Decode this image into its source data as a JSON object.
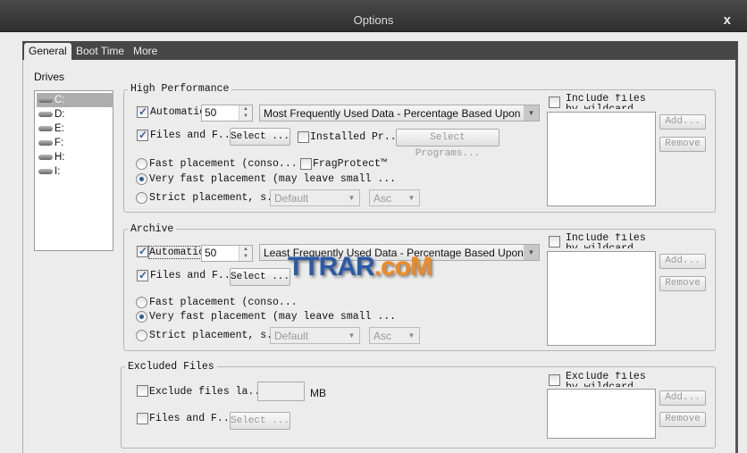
{
  "window": {
    "title": "Options",
    "close": "x"
  },
  "tabs": [
    {
      "label": "General",
      "selected": true
    },
    {
      "label": "Boot Time"
    },
    {
      "label": "More"
    }
  ],
  "drives": {
    "label": "Drives",
    "items": [
      "C:",
      "D:",
      "E:",
      "F:",
      "H:",
      "I:"
    ],
    "selected": "C:"
  },
  "high_performance": {
    "title": "High Performance",
    "automatic_label": "Automatic",
    "automatic_checked": true,
    "value": "50",
    "mode": "Most Frequently Used Data - Percentage Based Upon Data",
    "files_label": "Files and F...",
    "files_checked": true,
    "select_label": "Select ...",
    "installed_label": "Installed Pr...",
    "installed_checked": false,
    "select_programs_label": "Select Programs...",
    "fast_label": "Fast placement (conso...",
    "fragprotect_label": "FragProtect™",
    "very_fast_label": "Very fast placement (may leave small ...",
    "strict_label": "Strict placement, s...",
    "selected_placement": "very_fast",
    "sort": "Default",
    "order": "Asc",
    "include_label": "Include files by wildcard",
    "add_label": "Add...",
    "remove_label": "Remove"
  },
  "archive": {
    "title": "Archive",
    "automatic_label": "Automatic",
    "automatic_checked": true,
    "value": "50",
    "mode": "Least Frequently Used Data - Percentage Based Upon Data",
    "files_label": "Files and F...",
    "files_checked": true,
    "select_label": "Select ...",
    "fast_label": "Fast placement (conso...",
    "very_fast_label": "Very fast placement (may leave small ...",
    "strict_label": "Strict placement, s...",
    "selected_placement": "very_fast",
    "sort": "Default",
    "order": "Asc",
    "include_label": "Include files by wildcard",
    "add_label": "Add...",
    "remove_label": "Remove"
  },
  "excluded": {
    "title": "Excluded Files",
    "exclude_large_label": "Exclude files la...",
    "size_value": "",
    "unit": "MB",
    "files_label": "Files and F...",
    "select_label": "Select ...",
    "exclude_wildcard_label": "Exclude files by wildcard",
    "add_label": "Add...",
    "remove_label": "Remove"
  },
  "watermark": {
    "part1": "TTRAR",
    "part2": ".coM"
  },
  "colors": {
    "titlebar": "#3a3a3a",
    "tabstrip": "#474747",
    "body": "#ececec",
    "watermark_blue": "#2a5aa8",
    "watermark_orange": "#f08a20"
  }
}
